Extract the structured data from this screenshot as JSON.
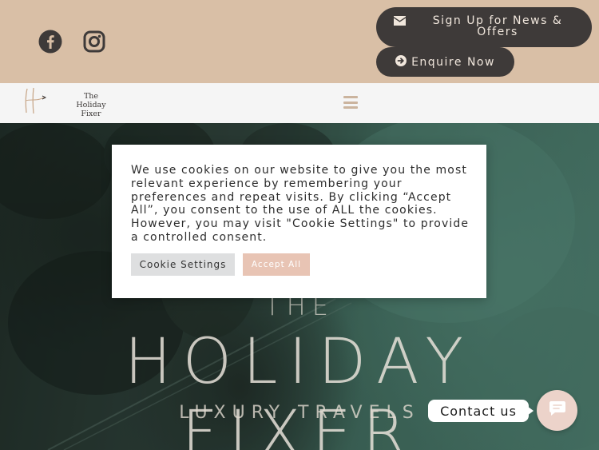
{
  "header": {
    "social": [
      {
        "icon": "facebook-icon"
      },
      {
        "icon": "instagram-icon"
      }
    ],
    "signup_label": "Sign Up for News & Offers",
    "enquire_label": "Enquire Now"
  },
  "nav": {
    "logo_line1": "The Holiday",
    "logo_line2": "Fixer",
    "menu_icon": "hamburger-icon"
  },
  "hero": {
    "the": "THE",
    "title": "HOLIDAY FIXER",
    "subtitle": "LUXURY TRAVELS"
  },
  "cookie": {
    "text": "We use cookies on our website to give you the most relevant experience by remembering your preferences and repeat visits. By clicking “Accept All”, you consent to the use of ALL the cookies. However, you may visit \"Cookie Settings\" to provide a controlled consent.",
    "settings_label": "Cookie Settings",
    "accept_label": "Accept All"
  },
  "contact": {
    "label": "Contact us",
    "icon": "chat-icon"
  },
  "colors": {
    "topbar": "#d9bfa6",
    "button_dark": "#3e3a39",
    "accept": "#e8c4b4",
    "fab": "#ecd3ca"
  }
}
